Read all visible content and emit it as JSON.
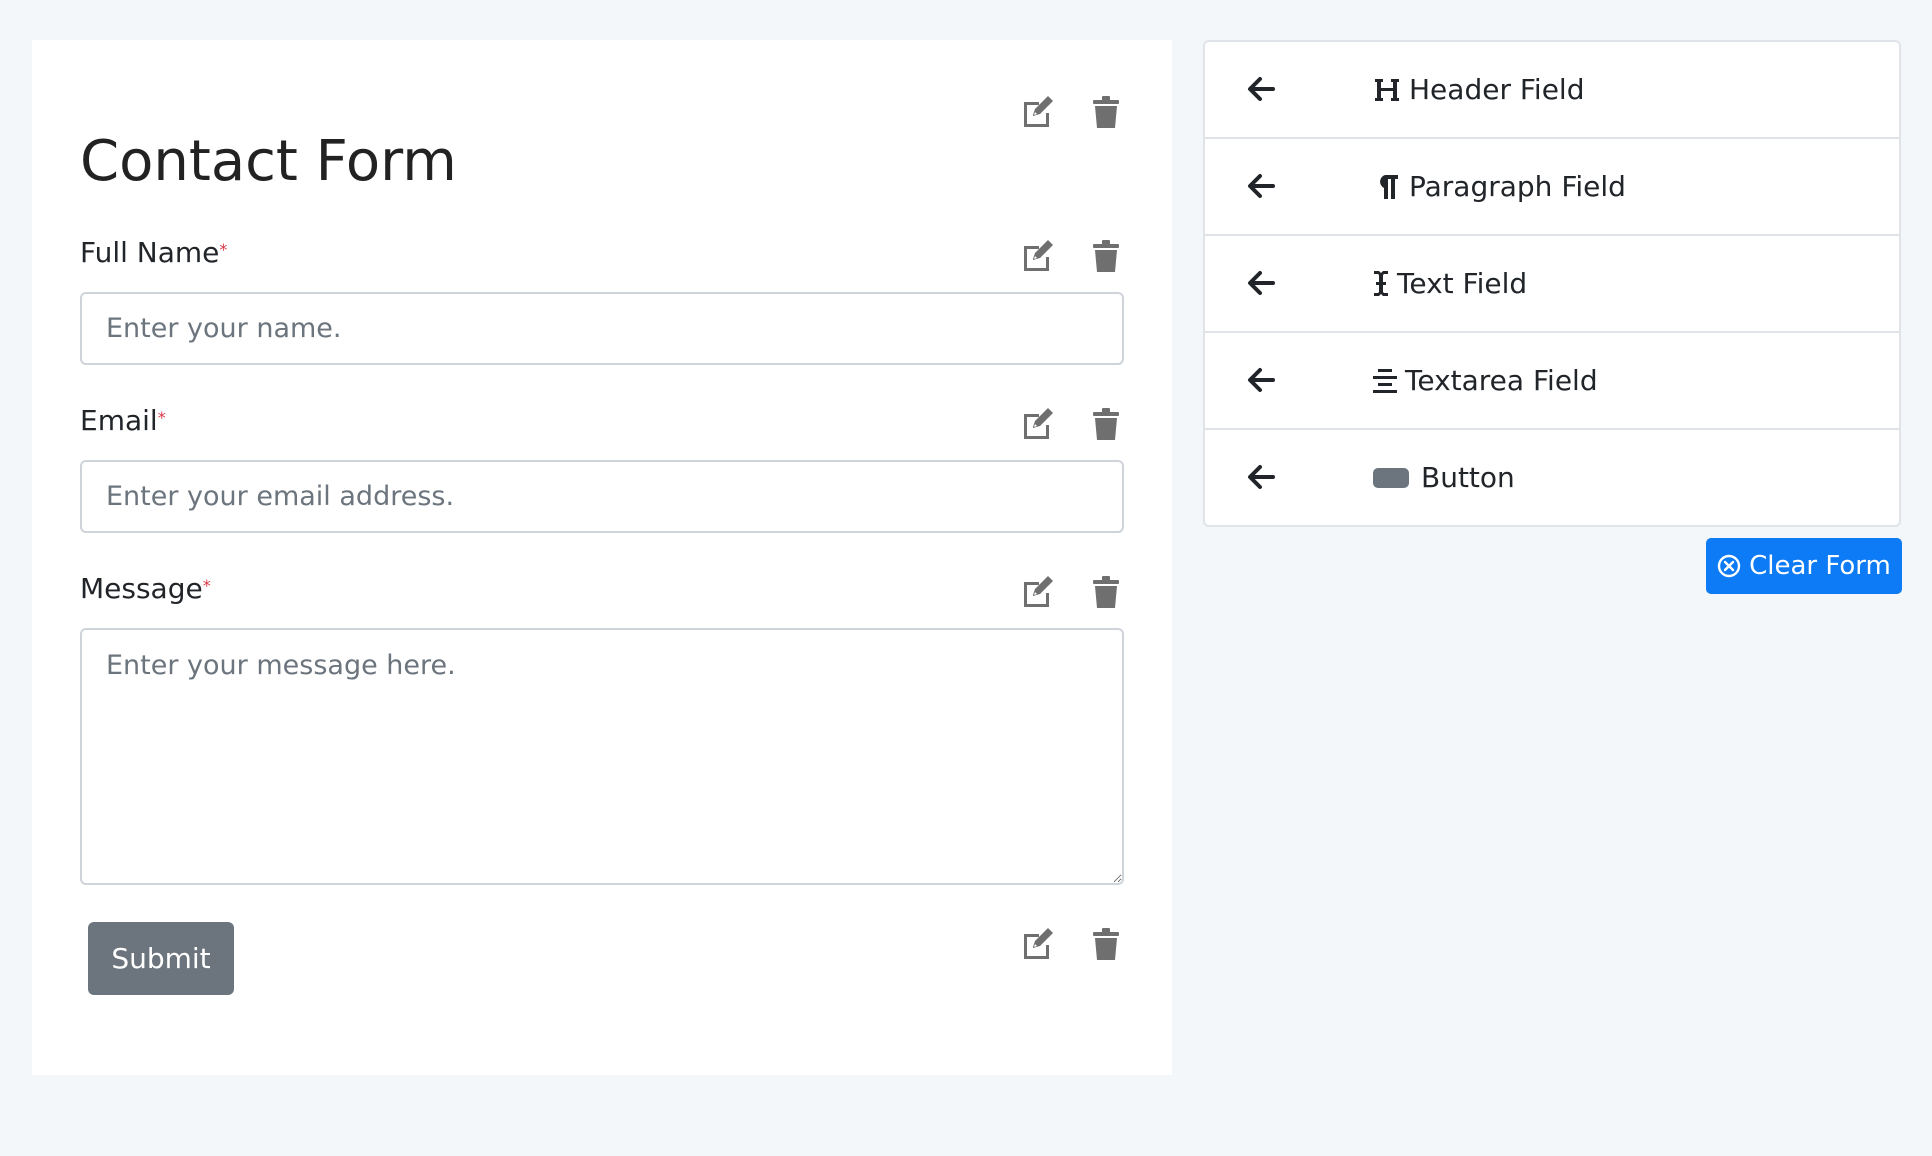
{
  "form": {
    "title": "Contact Form",
    "fields": [
      {
        "label": "Full Name",
        "required_mark": "*",
        "placeholder": "Enter your name."
      },
      {
        "label": "Email",
        "required_mark": "*",
        "placeholder": "Enter your email address."
      },
      {
        "label": "Message",
        "required_mark": "*",
        "placeholder": "Enter your message here."
      }
    ],
    "submit_label": "Submit"
  },
  "palette": {
    "items": [
      {
        "label": "Header Field",
        "icon": "header-icon"
      },
      {
        "label": "Paragraph Field",
        "icon": "paragraph-icon"
      },
      {
        "label": "Text Field",
        "icon": "text-cursor-icon"
      },
      {
        "label": "Textarea Field",
        "icon": "align-center-icon"
      },
      {
        "label": "Button",
        "icon": "button-shape-icon"
      }
    ]
  },
  "clear_form_label": "Clear Form",
  "colors": {
    "primary": "#0d7bf5",
    "secondary": "#6c757d",
    "required": "#dc3545",
    "icon_gray": "#6f6f6f"
  }
}
